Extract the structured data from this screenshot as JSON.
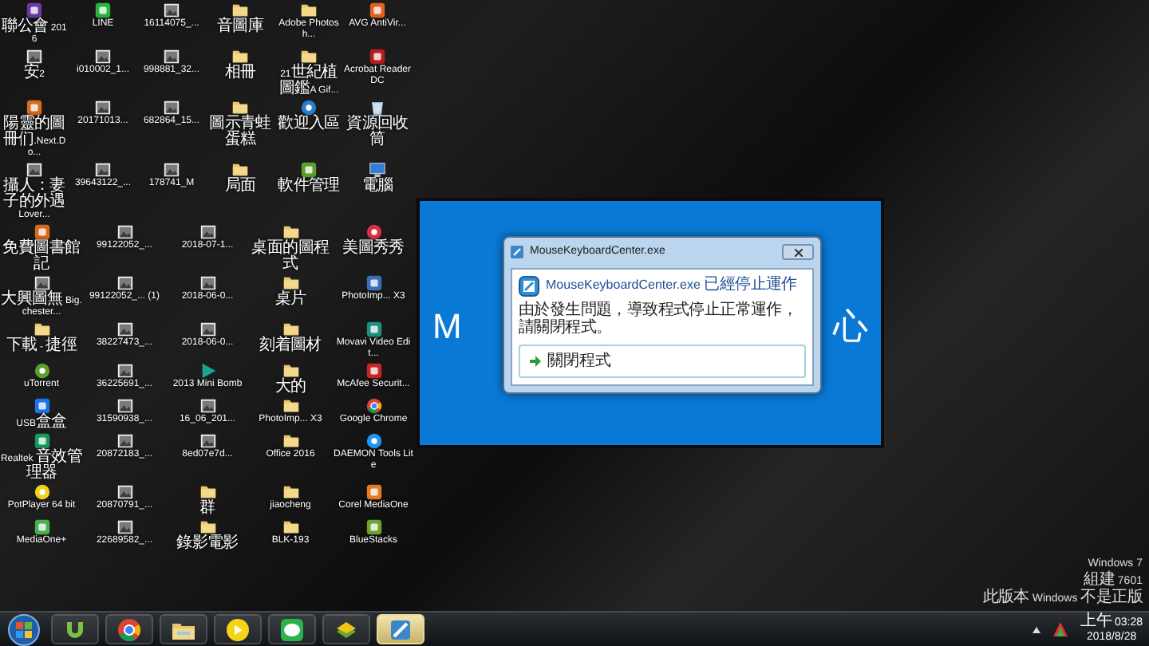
{
  "desktop": {
    "rows": [
      {
        "icons": [
          {
            "label": "聯公會 2016"
          },
          {
            "label": "LINE"
          },
          {
            "label": "16114075_..."
          },
          {
            "label": "音圖庫"
          },
          {
            "label": "Adobe Photosh..."
          },
          {
            "label": "AVG AntiVir..."
          }
        ]
      },
      {
        "icons": [
          {
            "label": "安2"
          },
          {
            "label": "i010002_1..."
          },
          {
            "label": "998881_32..."
          },
          {
            "label": "相冊"
          },
          {
            "label": "21世紀植圖鑑A Gif..."
          },
          {
            "label": "Acrobat Reader DC"
          }
        ]
      },
      {
        "icons": [
          {
            "label": "陽靈的圖冊们.Next.Do..."
          },
          {
            "label": "20171013..."
          },
          {
            "label": "682864_15..."
          },
          {
            "label": "圖示青蛙蛋糕"
          },
          {
            "label": "歡迎入區"
          },
          {
            "label": "資源回收筒"
          }
        ]
      },
      {
        "icons": [
          {
            "label": "攝人：妻子的外遇 Lover..."
          },
          {
            "label": "39643122_..."
          },
          {
            "label": "178741_M"
          },
          {
            "label": "局面"
          },
          {
            "label": "軟件管理"
          },
          {
            "label": "電腦"
          }
        ]
      },
      {
        "icons": [
          {
            "label": "免費圖書館記"
          },
          {
            "label": "99122052_..."
          },
          {
            "label": "2018-07-1..."
          },
          {
            "label": "桌面的圖程式"
          },
          {
            "label": "美圖秀秀"
          }
        ]
      },
      {
        "icons": [
          {
            "label": "大興圖無 Big.chester..."
          },
          {
            "label": "99122052_... (1)"
          },
          {
            "label": "2018-06-0..."
          },
          {
            "label": "桌片"
          },
          {
            "label": "PhotoImp... X3"
          }
        ]
      },
      {
        "icons": [
          {
            "label": "下載 - 捷徑"
          },
          {
            "label": "38227473_..."
          },
          {
            "label": "2018-06-0..."
          },
          {
            "label": "刻着圖材"
          },
          {
            "label": "Movavi Video Edit..."
          }
        ]
      },
      {
        "icons": [
          {
            "label": "uTorrent"
          },
          {
            "label": "36225691_..."
          },
          {
            "label": "2013 Mini Bomb"
          },
          {
            "label": "大的"
          },
          {
            "label": "McAfee Securit..."
          }
        ]
      },
      {
        "icons": [
          {
            "label": "USB盒盒"
          },
          {
            "label": "31590938_..."
          },
          {
            "label": "16_06_201..."
          },
          {
            "label": "PhotoImp... X3"
          },
          {
            "label": "Google Chrome"
          }
        ]
      },
      {
        "icons": [
          {
            "label": "Realtek 音效管理器"
          },
          {
            "label": "20872183_..."
          },
          {
            "label": "8ed07e7d..."
          },
          {
            "label": "Office 2016"
          },
          {
            "label": "DAEMON Tools Lite"
          }
        ]
      },
      {
        "icons": [
          {
            "label": "PotPlayer 64 bit"
          },
          {
            "label": "20870791_..."
          },
          {
            "label": "群"
          },
          {
            "label": "jiaocheng"
          },
          {
            "label": "Corel MediaOne"
          }
        ]
      },
      {
        "icons": [
          {
            "label": "MediaOne+"
          },
          {
            "label": "22689582_..."
          },
          {
            "label": "錄影電影"
          },
          {
            "label": "BLK-193"
          },
          {
            "label": "BlueStacks"
          }
        ]
      }
    ]
  },
  "splash": {
    "text_left": "M",
    "text_right": "心"
  },
  "dialog": {
    "title": "MouseKeyboardCenter.exe",
    "heading": "MouseKeyboardCenter.exe 已經停止運作",
    "message": "由於發生問題，導致程式停止正常運作，請關閉程式。",
    "button": "關閉程式"
  },
  "windows_notice": [
    "Windows 7",
    "組建 7601",
    "此版本 Windows 不是正版"
  ],
  "taskbar": {
    "buttons": [
      {
        "selected": false
      },
      {
        "selected": false
      },
      {
        "selected": false
      },
      {
        "selected": false
      },
      {
        "selected": false
      },
      {
        "selected": false
      },
      {
        "selected": true
      }
    ],
    "clock": {
      "time": "上午 03:28",
      "date": "2018/8/28"
    }
  }
}
